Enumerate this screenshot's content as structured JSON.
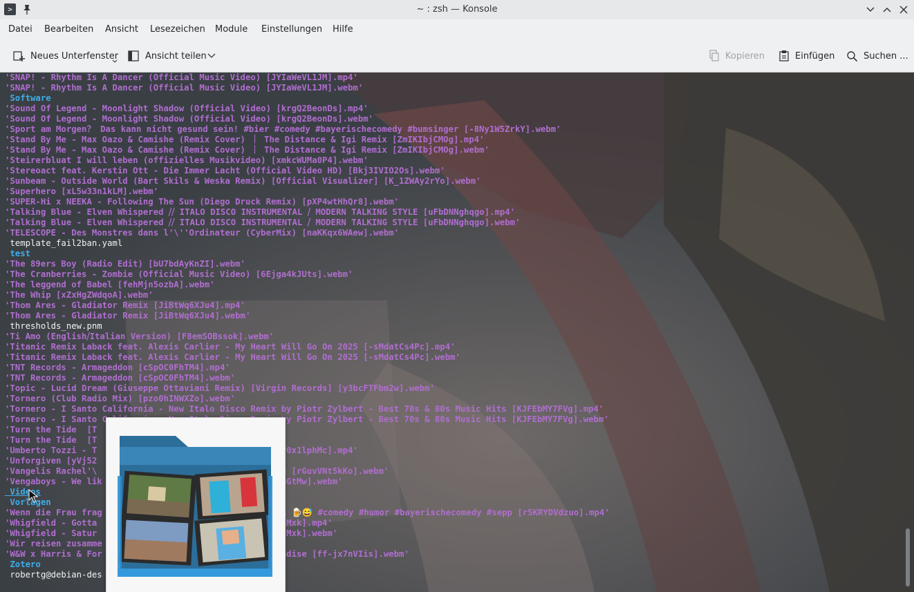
{
  "window": {
    "title": "~ : zsh — Konsole"
  },
  "menu": {
    "items": [
      "Datei",
      "Bearbeiten",
      "Ansicht",
      "Lesezeichen",
      "Module",
      "Einstellungen",
      "Hilfe"
    ]
  },
  "toolbar": {
    "new_tab": "Neues Unterfenster",
    "split_view": "Ansicht teilen",
    "copy": "Kopieren",
    "paste": "Einfügen",
    "find": "Suchen ..."
  },
  "terminal": {
    "lines": [
      {
        "text": "'SNAP! - Rhythm Is A Dancer (Official Music Video) [JYIaWeVL1JM].mp4'",
        "kind": "file"
      },
      {
        "text": "'SNAP! - Rhythm Is A Dancer (Official Music Video) [JYIaWeVL1JM].webm'",
        "kind": "file"
      },
      {
        "text": " Software",
        "kind": "dir"
      },
      {
        "text": "'Sound Of Legend - Moonlight Shadow (Official Video) [krgQ2BeonDs].mp4'",
        "kind": "file"
      },
      {
        "text": "'Sound Of Legend - Moonlight Shadow (Official Video) [krgQ2BeonDs].webm'",
        "kind": "file"
      },
      {
        "text": "'Sport am Morgen？ Das kann nicht gesund sein! #bier #comedy #bayerischecomedy #bumsinger [-8Ny1W5ZrkY].webm'",
        "kind": "file"
      },
      {
        "text": "'Stand By Me - Max Oazo & Camishe (Remix Cover) ｜ The Distance & Igi Remix [ZmIKIbjCMOg].mp4'",
        "kind": "file"
      },
      {
        "text": "'Stand By Me - Max Oazo & Camishe (Remix Cover) ｜ The Distance & Igi Remix [ZmIKIbjCMOg].webm'",
        "kind": "file"
      },
      {
        "text": "'Steirerbluat I will leben (offizielles Musikvideo) [xmkcWUMa0P4].webm'",
        "kind": "file"
      },
      {
        "text": "'Stereoact feat. Kerstin Ott - Die Immer Lacht (Official Video HD) [Bkj3IVIO2Os].webm'",
        "kind": "file"
      },
      {
        "text": "'Sunbeam - Outside World (Bart Skils & Weska Remix) [Official Visualizer] [K_1ZWAy2rYo].webm'",
        "kind": "file"
      },
      {
        "text": "'Superhero [xL5w33n1kLM].webm'",
        "kind": "file"
      },
      {
        "text": "'SUPER-Hi x NEEKA - Following The Sun (Diego Druck Remix) [pXP4wtHhQr8].webm'",
        "kind": "file"
      },
      {
        "text": "'Talking Blue - Elven Whispered ⧸⧸ ITALO DISCO INSTRUMENTAL ⧸ MODERN TALKING STYLE [uFbDNNghqgo].mp4'",
        "kind": "file"
      },
      {
        "text": "'Talking Blue - Elven Whispered ⧸⧸ ITALO DISCO INSTRUMENTAL ⧸ MODERN TALKING STYLE [uFbDNNghqgo].webm'",
        "kind": "file"
      },
      {
        "text": "'TELESCOPE - Des Monstres dans l'\\''Ordinateur (CyberMix) [naKKqx6WAew].webm'",
        "kind": "file"
      },
      {
        "text": " template_fail2ban.yaml",
        "kind": "plain"
      },
      {
        "text": " test",
        "kind": "dir"
      },
      {
        "text": "'The 89ers Boy (Radio Edit) [bU7bdAyKnZI].webm'",
        "kind": "file"
      },
      {
        "text": "'The Cranberries - Zombie (Official Music Video) [6Ejga4kJUts].webm'",
        "kind": "file"
      },
      {
        "text": "'The leggend of Babel [fehMjn5ozbA].webm'",
        "kind": "file"
      },
      {
        "text": "'The Whip [xZxHgZWdqoA].webm'",
        "kind": "file"
      },
      {
        "text": "'Thom Ares - Gladiator Remix [JiBtWq6XJu4].mp4'",
        "kind": "file"
      },
      {
        "text": "'Thom Ares - Gladiator Remix [JiBtWq6XJu4].webm'",
        "kind": "file"
      },
      {
        "text": " thresholds_new.pnm",
        "kind": "plain"
      },
      {
        "text": "'Ti Amo (English⧸Italian Version) [F8emSOBssok].webm'",
        "kind": "file"
      },
      {
        "text": "'Titanic Remix Laback feat. Alexis Carlier - My Heart Will Go On 2025 [-sMdatCs4Pc].mp4'",
        "kind": "file"
      },
      {
        "text": "'Titanic Remix Laback feat. Alexis Carlier - My Heart Will Go On 2025 [-sMdatCs4Pc].webm'",
        "kind": "file"
      },
      {
        "text": "'TNT Records - Armageddon [cSpOC0FhTM4].mp4'",
        "kind": "file"
      },
      {
        "text": "'TNT Records - Armageddon [cSpOC0FhTM4].webm'",
        "kind": "file"
      },
      {
        "text": "'Topic - Lucid Dream (Giuseppe Ottaviani Remix) [Virgin Records] [y3bcFTFbm2w].webm'",
        "kind": "file"
      },
      {
        "text": "'Tornero (Club Radio Mix) [pzo0hINWXZo].webm'",
        "kind": "file"
      },
      {
        "text": "'Tornero - I Santo California - New Italo Disco Remix by Piotr Zylbert - Best 70s & 80s Music Hits [KJFEbMY7FVg].mp4'",
        "kind": "file"
      },
      {
        "text": "'Tornero - I Santo California - New Italo Disco Remix by Piotr Zylbert - Best 70s & 80s Music Hits [KJFEbMY7FVg].webm'",
        "kind": "file"
      },
      {
        "text": "'Turn the Tide  [T                                  '",
        "kind": "file"
      },
      {
        "text": "'Turn the Tide  [T                                  '",
        "kind": "file"
      },
      {
        "text": "'Umberto Tozzi - T                                  h_P0x1lphMc].mp4'",
        "kind": "file"
      },
      {
        "text": "'Unforgiven [yVj52",
        "kind": "file"
      },
      {
        "text": "'Vangelis Rachel'\\                                  one [rGuvVNt5kKo].webm'",
        "kind": "file"
      },
      {
        "text": "'Vengaboys - We lik                                 0XmGtMw].webm'",
        "kind": "file"
      },
      {
        "text": " Videos",
        "kind": "dir",
        "underline": true
      },
      {
        "text": " Vorlagen",
        "kind": "dir"
      },
      {
        "text": "'Wenn die Frau frag                                 mm… 🍺😅 #comedy #humor #bayerischecomedy #sepp [r5KRYDVdzuo].mp4'",
        "kind": "file"
      },
      {
        "text": "'Whigfield - Gotta                                  tmIMxk].mp4'",
        "kind": "file"
      },
      {
        "text": "'Whigfield - Satur                                  tmIMxk].webm'",
        "kind": "file"
      },
      {
        "text": "'Wir reisen zusamme",
        "kind": "file"
      },
      {
        "text": "'W&W x Harris & For                                 aradise [ff-jx7nVIis].webm'",
        "kind": "file"
      },
      {
        "text": " Zotero",
        "kind": "dir"
      },
      {
        "text": " robertg@debian-des",
        "kind": "plain"
      }
    ]
  },
  "icons": {
    "app": "terminal-app-icon",
    "pin": "pin-icon",
    "minimize": "chevron-down-icon",
    "maximize": "chevron-up-icon",
    "close": "close-icon",
    "new_tab": "new-tab-icon",
    "split": "split-view-icon",
    "copy": "copy-icon",
    "paste": "paste-icon",
    "find": "search-icon",
    "preview": "video-folder-icon"
  },
  "colors": {
    "file": "#b06ecf",
    "dir": "#3daee9",
    "plain": "#f2f2f2",
    "folder": "#2f7fb3"
  }
}
